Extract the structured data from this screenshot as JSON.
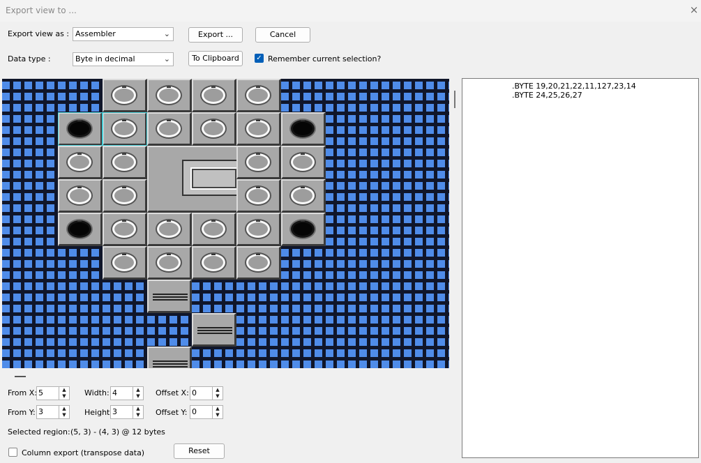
{
  "window": {
    "title": "Export view to ...",
    "close_icon": "×"
  },
  "export_as": {
    "label": "Export view as :",
    "value": "Assembler"
  },
  "data_type": {
    "label": "Data type :",
    "value": "Byte in decimal"
  },
  "buttons": {
    "export": "Export ...",
    "cancel": "Cancel",
    "clipboard": "To Clipboard",
    "reset": "Reset"
  },
  "remember": {
    "label": "Remember current selection?",
    "checked": true
  },
  "output_text": "      .BYTE 19,20,21,22,11,127,23,14\n      .BYTE 24,25,26,27",
  "region": {
    "from_x": {
      "label": "From X:",
      "value": "5"
    },
    "from_y": {
      "label": "From Y:",
      "value": "3"
    },
    "width": {
      "label": "Width:",
      "value": "4"
    },
    "height": {
      "label": "Height:",
      "value": "3"
    },
    "offset_x": {
      "label": "Offset X:",
      "value": "0"
    },
    "offset_y": {
      "label": "Offset Y:",
      "value": "0"
    },
    "selected_label": "Selected region:",
    "selected_value": "(5, 3) - (4, 3) @ 12 bytes"
  },
  "column_export": {
    "label": "Column export (transpose data)",
    "checked": false
  }
}
